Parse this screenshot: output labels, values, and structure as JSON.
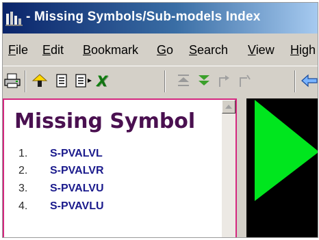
{
  "window": {
    "title": "- Missing Symbols/Sub-models Index",
    "app_icon": "model-viewer-app-icon"
  },
  "menu": [
    {
      "label": "File",
      "mnemonic": "F",
      "rest": "ile"
    },
    {
      "label": "Edit",
      "mnemonic": "E",
      "rest": "dit"
    },
    {
      "label": "Bookmark",
      "mnemonic": "B",
      "rest": "ookmark"
    },
    {
      "label": "Go",
      "mnemonic": "G",
      "rest": "o"
    },
    {
      "label": "Search",
      "mnemonic": "S",
      "rest": "earch"
    },
    {
      "label": "View",
      "mnemonic": "V",
      "rest": "iew"
    },
    {
      "label": "High",
      "mnemonic": "H",
      "rest": "igh"
    }
  ],
  "toolbar": {
    "icons": [
      "print-icon",
      "home-icon",
      "page-icon",
      "page-forward-icon",
      "excel-icon",
      "up-arrow-icon",
      "down-arrow-icon",
      "step-up-icon",
      "step-down-icon",
      "back-arrow-icon"
    ]
  },
  "content": {
    "heading": "Missing Symbol",
    "items": [
      {
        "number": "1.",
        "name": "S-PVALVL"
      },
      {
        "number": "2.",
        "name": "S-PVALVR"
      },
      {
        "number": "3.",
        "name": "S-PVALVU"
      },
      {
        "number": "4.",
        "name": "S-PVAVLU"
      }
    ]
  },
  "colors": {
    "title_bar_start": "#0a246a",
    "title_bar_end": "#a6caf0",
    "heading": "#4a1050",
    "link": "#1a1a8c",
    "pane_border": "#d4267e",
    "preview_shape": "#00e61e",
    "preview_background": "#000000"
  }
}
